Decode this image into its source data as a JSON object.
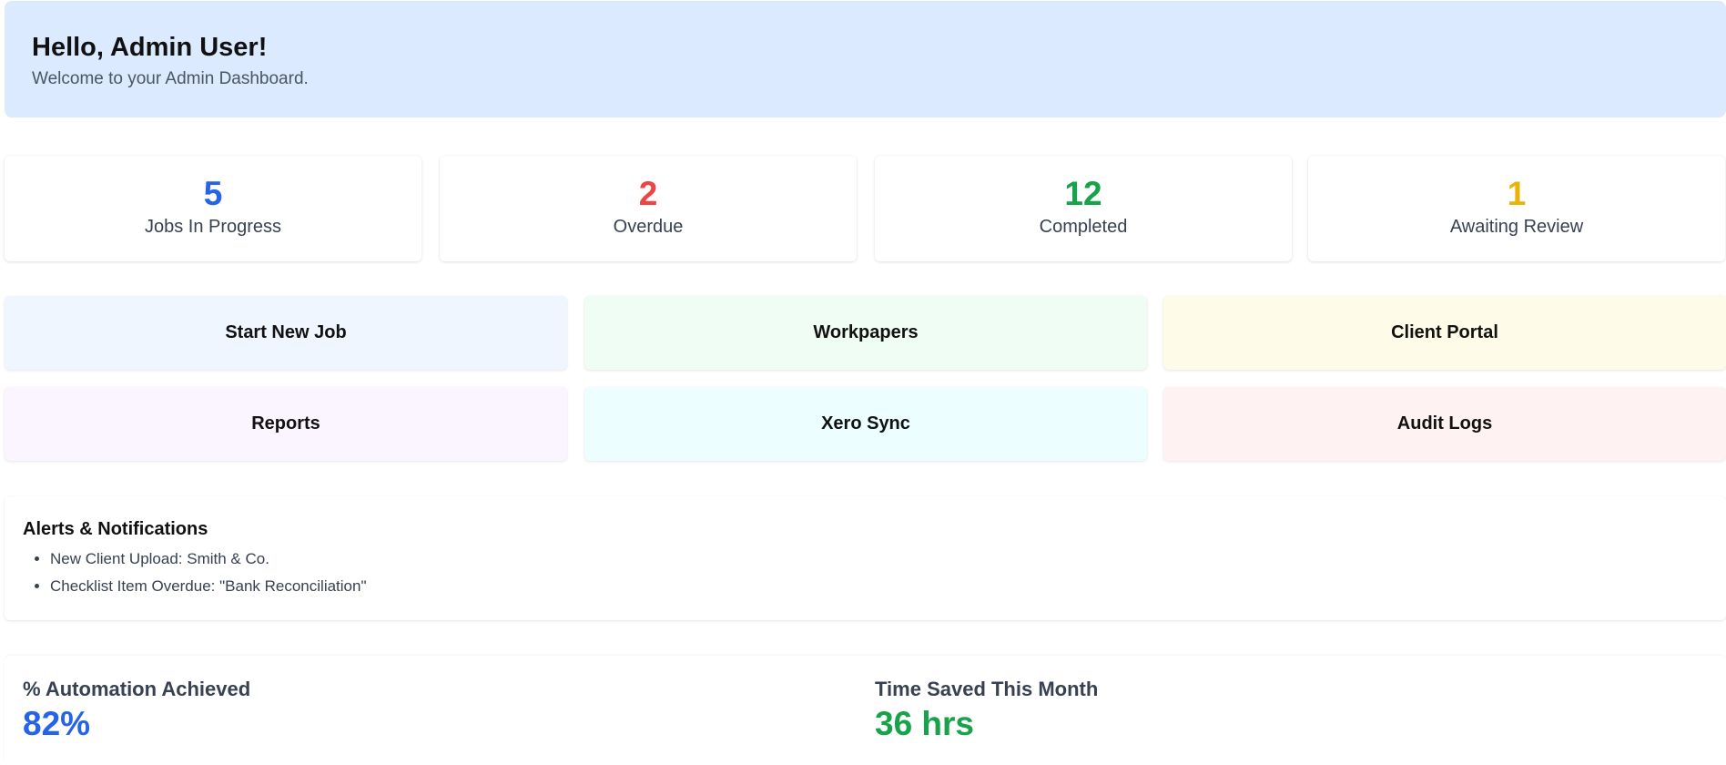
{
  "header": {
    "greeting": "Hello, Admin User!",
    "subtitle": "Welcome to your Admin Dashboard."
  },
  "stats": [
    {
      "value": "5",
      "label": "Jobs In Progress",
      "color": "#2563eb"
    },
    {
      "value": "2",
      "label": "Overdue",
      "color": "#ef4444"
    },
    {
      "value": "12",
      "label": "Completed",
      "color": "#16a34a"
    },
    {
      "value": "1",
      "label": "Awaiting Review",
      "color": "#eab308"
    }
  ],
  "actions": [
    {
      "label": "Start New Job",
      "color": "#eff6ff"
    },
    {
      "label": "Workpapers",
      "color": "#f0fdf4"
    },
    {
      "label": "Client Portal",
      "color": "#fefce8"
    },
    {
      "label": "Reports",
      "color": "#faf5ff"
    },
    {
      "label": "Xero Sync",
      "color": "#ecfeff"
    },
    {
      "label": "Audit Logs",
      "color": "#fef2f2"
    }
  ],
  "alerts": {
    "title": "Alerts & Notifications",
    "items": [
      "New Client Upload: Smith & Co.",
      "Checklist Item Overdue: \"Bank Reconciliation\""
    ]
  },
  "metrics": [
    {
      "label": "% Automation Achieved",
      "value": "82%",
      "color": "#2563eb"
    },
    {
      "label": "Time Saved This Month",
      "value": "36 hrs",
      "color": "#16a34a"
    }
  ]
}
